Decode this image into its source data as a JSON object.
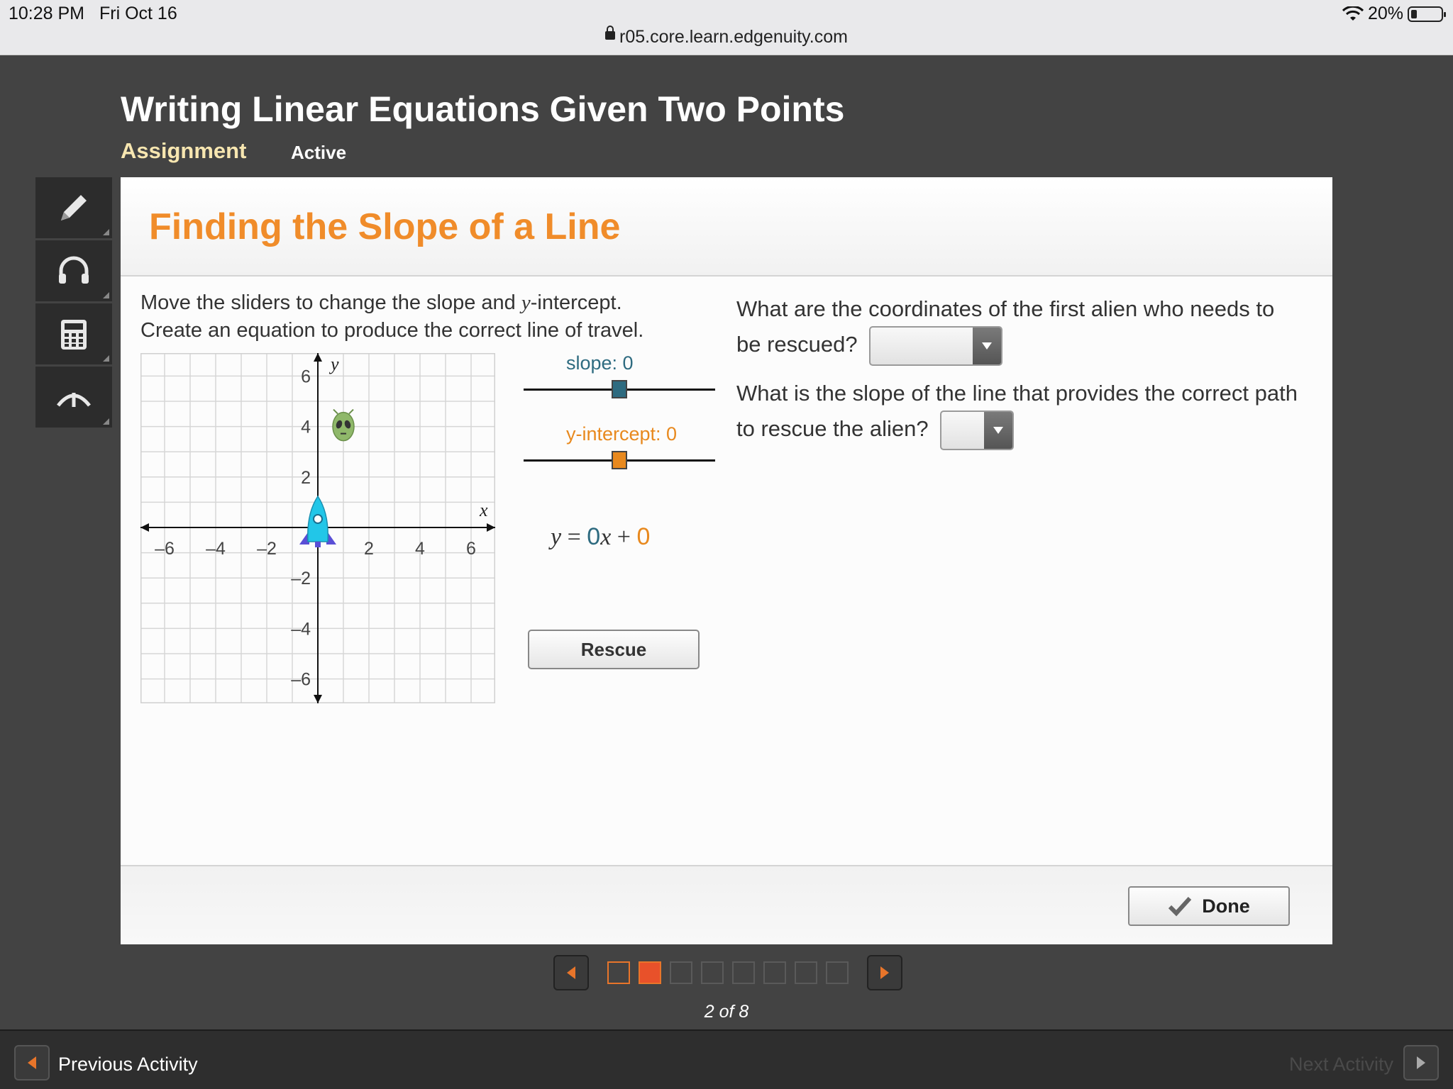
{
  "status_bar": {
    "time": "10:28 PM",
    "date": "Fri Oct 16",
    "battery": "20%",
    "url": "r05.core.learn.edgenuity.com"
  },
  "header": {
    "title": "Writing Linear Equations Given Two Points",
    "tab_assignment": "Assignment",
    "tab_status": "Active"
  },
  "tools": [
    "pencil-icon",
    "headphones-icon",
    "calculator-icon",
    "arrow-up-icon"
  ],
  "activity": {
    "title": "Finding the Slope of a Line",
    "instruction_1_pre": "Move the sliders to change the slope and ",
    "instruction_1_var": "y",
    "instruction_1_post": "-intercept.",
    "instruction_2": "Create an equation to produce the correct line of travel."
  },
  "graph": {
    "x_label": "x",
    "y_label": "y",
    "x_ticks": [
      "–6",
      "–4",
      "–2",
      "2",
      "4",
      "6"
    ],
    "y_ticks": [
      "6",
      "4",
      "2",
      "–2",
      "–4",
      "–6"
    ],
    "alien_position": [
      1,
      4
    ],
    "rocket_position": [
      0,
      0
    ]
  },
  "sliders": {
    "slope_label": "slope: 0",
    "intercept_label": "y-intercept: 0",
    "slope_value": 0,
    "intercept_value": 0
  },
  "equation": {
    "y": "y",
    "eq": " = ",
    "m": "0",
    "x": "x",
    "plus": " + ",
    "b": "0"
  },
  "rescue_label": "Rescue",
  "questions": {
    "q1": "What are the coordinates of the first alien who needs to be rescued?",
    "q2": "What is the slope of the line that provides the correct path to rescue the alien?"
  },
  "done_label": "Done",
  "pager": {
    "current": 2,
    "total": 8,
    "label": "2 of 8"
  },
  "footer": {
    "prev_label": "Previous Activity",
    "next_label": "Next Activity"
  },
  "colors": {
    "title_orange": "#f08c2a",
    "slope_teal": "#2e6b80",
    "intercept_orange": "#e8891e",
    "current_page": "#e8512a"
  }
}
